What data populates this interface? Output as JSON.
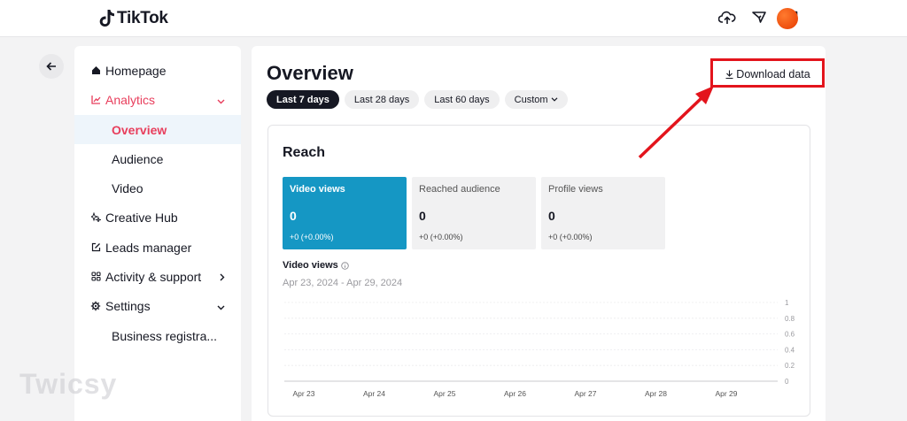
{
  "app": {
    "name": "TikTok",
    "header_icons": [
      "upload-cloud-icon",
      "filter-send-icon",
      "message-icon"
    ]
  },
  "sidebar": {
    "items": [
      {
        "label": "Homepage",
        "icon": "home-icon"
      },
      {
        "label": "Analytics",
        "icon": "chart-icon"
      },
      {
        "label": "Overview"
      },
      {
        "label": "Audience"
      },
      {
        "label": "Video"
      },
      {
        "label": "Creative Hub",
        "icon": "sparkle-icon"
      },
      {
        "label": "Leads manager",
        "icon": "edit-icon"
      },
      {
        "label": "Activity & support",
        "icon": "grid-icon"
      },
      {
        "label": "Settings",
        "icon": "gear-icon"
      },
      {
        "label": "Business registra..."
      }
    ]
  },
  "main": {
    "title": "Overview",
    "download_label": "Download data",
    "date_filters": [
      "Last 7 days",
      "Last 28 days",
      "Last 60 days",
      "Custom"
    ],
    "selected_filter": "Last 7 days"
  },
  "reach": {
    "title": "Reach",
    "metrics": [
      {
        "label": "Video views",
        "value": "0",
        "delta": "+0  (+0.00%)"
      },
      {
        "label": "Reached audience",
        "value": "0",
        "delta": "+0  (+0.00%)"
      },
      {
        "label": "Profile views",
        "value": "0",
        "delta": "+0  (+0.00%)"
      }
    ],
    "chart_label": "Video views",
    "chart_range": "Apr 23, 2024 - Apr 29, 2024"
  },
  "chart_data": {
    "type": "line",
    "categories": [
      "Apr 23",
      "Apr 24",
      "Apr 25",
      "Apr 26",
      "Apr 27",
      "Apr 28",
      "Apr 29"
    ],
    "series": [
      {
        "values": [
          0,
          0,
          0,
          0,
          0,
          0,
          0
        ]
      }
    ],
    "yticks": [
      "1",
      "0.8",
      "0.6",
      "0.4",
      "0.2",
      "0"
    ],
    "ylim": [
      0,
      1
    ],
    "grid": true
  },
  "colors": {
    "accent": "#e83e5c",
    "metric_active": "#1597c4",
    "annotation": "#e3141c"
  },
  "watermark": "Twicsy"
}
